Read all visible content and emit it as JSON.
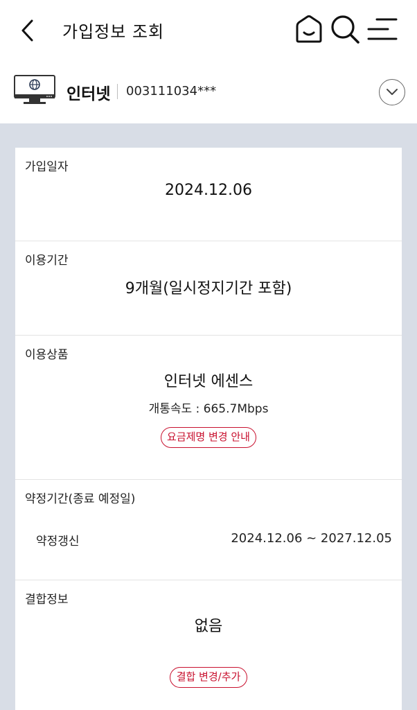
{
  "header": {
    "title": "가입정보 조회",
    "icons": [
      "back-arrow-icon",
      "home-icon",
      "search-icon",
      "menu-icon"
    ]
  },
  "service": {
    "icon": "monitor-icon",
    "name": "인터넷",
    "number": "003111034***",
    "expand_icon": "chevron-down-icon"
  },
  "sections": {
    "join_date": {
      "label": "가입일자",
      "value": "2024.12.06"
    },
    "usage_period": {
      "label": "이용기간",
      "value": "9개월(일시정지기간 포함)"
    },
    "product": {
      "label": "이용상품",
      "value": "인터넷 에센스",
      "speed": "개통속도 : 665.7Mbps",
      "button": "요금제명 변경 안내"
    },
    "contract": {
      "label": "약정기간(종료 예정일)",
      "type": "약정갱신",
      "period": "2024.12.06 ~ 2027.12.05"
    },
    "bundle": {
      "label": "결합정보",
      "value": "없음",
      "button": "결합 변경/추가"
    }
  },
  "colors": {
    "accent_red": "#c8102e",
    "page_bg": "#d8dde6",
    "card_bg": "#ffffff"
  }
}
